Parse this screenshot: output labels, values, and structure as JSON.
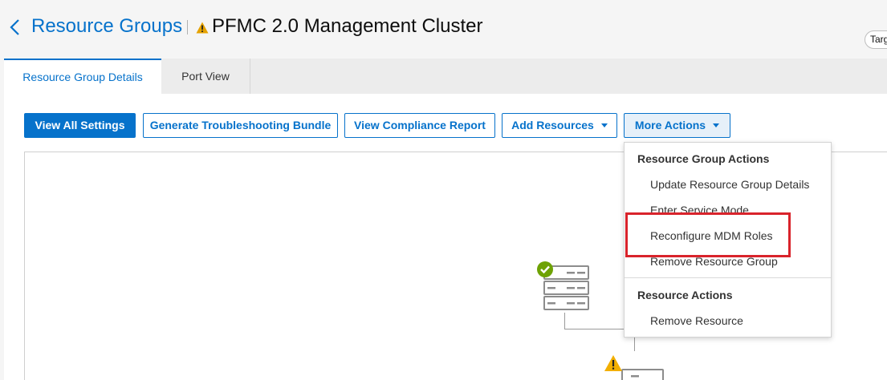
{
  "header": {
    "breadcrumb": "Resource Groups",
    "title": "PFMC 2.0 Management Cluster",
    "target_pill": "Targ",
    "status_icon": "warning-icon",
    "status_color": "#e5a200"
  },
  "tabs": [
    {
      "label": "Resource Group Details",
      "active": true
    },
    {
      "label": "Port View",
      "active": false
    }
  ],
  "toolbar": {
    "view_all_settings": "View All Settings",
    "generate_bundle": "Generate Troubleshooting Bundle",
    "view_compliance": "View Compliance Report",
    "add_resources": "Add Resources",
    "more_actions": "More Actions"
  },
  "menu": {
    "group_actions_heading": "Resource Group Actions",
    "items": [
      "Update Resource Group Details",
      "Enter Service Mode",
      "Reconfigure MDM Roles",
      "Remove Resource Group"
    ],
    "resource_actions_heading": "Resource Actions",
    "resource_items": [
      "Remove Resource"
    ],
    "highlighted_item": "Reconfigure MDM Roles"
  },
  "topology": {
    "nodes": [
      {
        "icon": "server-icon",
        "status": "ok",
        "status_icon": "check-icon"
      },
      {
        "icon": "server-icon",
        "status": "warning",
        "status_icon": "warning-icon"
      }
    ]
  },
  "colors": {
    "accent": "#0672cb",
    "success": "#6ea204",
    "warning": "#f2af00",
    "highlight": "#d9232b"
  }
}
